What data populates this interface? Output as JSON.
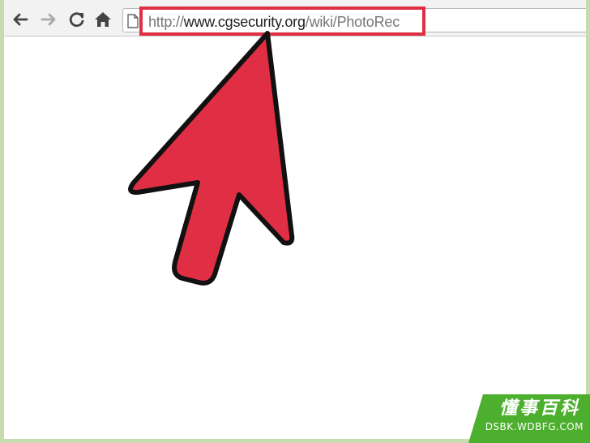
{
  "browser": {
    "nav_icons": [
      "back-arrow-icon",
      "forward-arrow-icon",
      "reload-icon",
      "home-icon",
      "page-icon"
    ],
    "address": {
      "scheme": "http://",
      "host": "www.cgsecurity.org",
      "path": "/wiki/PhotoRec"
    }
  },
  "annotation": {
    "highlight_color": "#e02f44",
    "arrow_color": "#e02f44"
  },
  "watermark": {
    "title": "懂事百科",
    "site": "DSBK.WDBFG.COM",
    "color": "#4caf2e"
  },
  "colors": {
    "background": "#c6dbb0",
    "toolbar": "#f2f2f2"
  }
}
